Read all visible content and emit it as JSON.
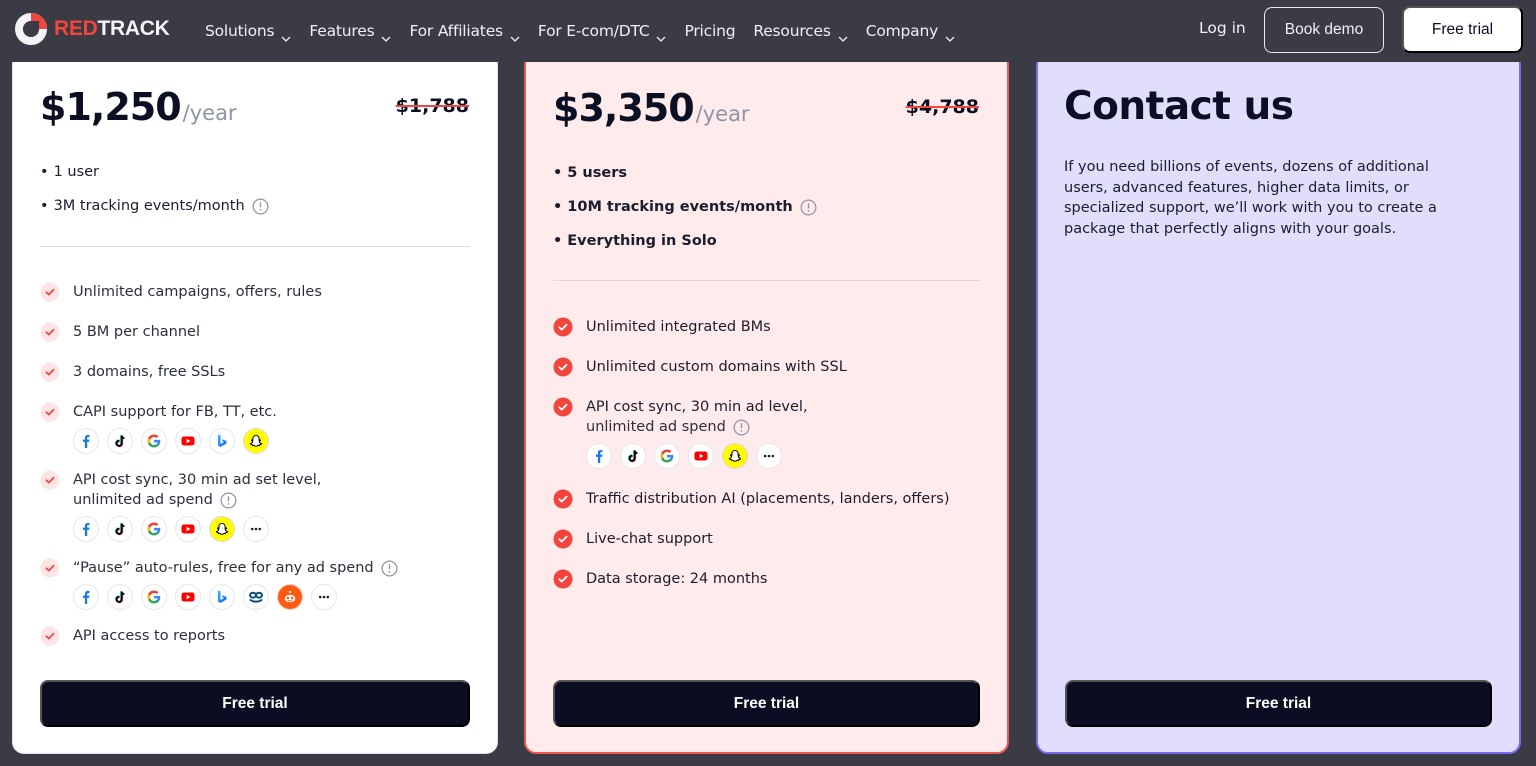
{
  "brand": {
    "name_red": "RED",
    "name_white": "TRACK",
    "accent": "#f2453d",
    "dark": "#0b0e23",
    "nav_bg": "#3b3b45"
  },
  "nav": {
    "items": [
      {
        "label": "Solutions",
        "dropdown": true
      },
      {
        "label": "Features",
        "dropdown": true
      },
      {
        "label": "For Affiliates",
        "dropdown": true
      },
      {
        "label": "For E-com/DTC",
        "dropdown": true
      },
      {
        "label": "Pricing",
        "dropdown": false
      },
      {
        "label": "Resources",
        "dropdown": true
      },
      {
        "label": "Company",
        "dropdown": true
      }
    ],
    "login": "Log in",
    "book_demo": "Book demo",
    "free_trial": "Free trial"
  },
  "plans": {
    "solo": {
      "price": "$1,250",
      "period": "/year",
      "old_price": "$1,788",
      "bullets": [
        "1 user",
        "3M tracking events/month"
      ],
      "features": [
        {
          "text": "Unlimited campaigns, offers, rules"
        },
        {
          "text": "5 BM per channel"
        },
        {
          "text": "3 domains, free SSLs"
        },
        {
          "text": "CAPI support for FB, TT, etc.",
          "icons": [
            "facebook-icon",
            "tiktok-icon",
            "google-icon",
            "youtube-icon",
            "bing-icon",
            "snapchat-icon"
          ]
        },
        {
          "text": "API cost sync, 30 min ad set level,",
          "text2": "unlimited ad spend",
          "icons": [
            "facebook-icon",
            "tiktok-icon",
            "google-icon",
            "youtube-icon",
            "snapchat-icon",
            "more-icon"
          ]
        },
        {
          "text": "“Pause” auto-rules, free for any ad spend",
          "icons": [
            "facebook-icon",
            "tiktok-icon",
            "google-icon",
            "youtube-icon",
            "bing-icon",
            "taboola-icon",
            "reddit-icon",
            "more-icon"
          ]
        },
        {
          "text": "API access to reports"
        }
      ],
      "cta": "Free trial"
    },
    "team": {
      "price": "$3,350",
      "period": "/year",
      "old_price": "$4,788",
      "bullets": [
        "5 users",
        "10M tracking events/month",
        "Everything in Solo"
      ],
      "features": [
        {
          "text": "Unlimited integrated BMs"
        },
        {
          "text": "Unlimited custom domains with SSL"
        },
        {
          "text": "API cost sync, 30 min ad level,",
          "text2": "unlimited ad spend",
          "icons": [
            "facebook-icon",
            "tiktok-icon",
            "google-icon",
            "youtube-icon",
            "snapchat-icon",
            "more-icon"
          ]
        },
        {
          "text": "Traffic distribution AI (placements, landers, offers)"
        },
        {
          "text": "Live-chat support"
        },
        {
          "text": "Data storage: 24 months"
        }
      ],
      "cta": "Free trial"
    },
    "enterprise": {
      "title": "Contact us",
      "description": "If you need billions of events, dozens of additional users, advanced features, higher data limits, or specialized support, we’ll work with you to create a package that perfectly aligns with your goals.",
      "cta": "Free trial"
    }
  }
}
